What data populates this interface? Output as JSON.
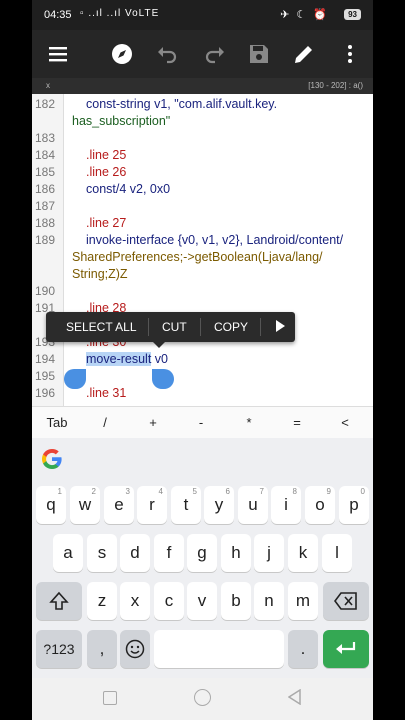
{
  "status": {
    "time": "04:35",
    "left_icons": "▫ ..ıl ..ıl VoLTE",
    "right_icons": "✈ ☾ ⏰",
    "battery": "93"
  },
  "toolbar": {
    "icons": [
      "menu-icon",
      "compass-icon",
      "undo-icon",
      "redo-icon",
      "save-icon",
      "edit-icon",
      "more-vert-icon"
    ]
  },
  "infobar": {
    "close": "x",
    "position": "[130 - 202] : a()"
  },
  "editor": {
    "lines": [
      {
        "n": "182",
        "text": "const-string  v1, \"com.alif.vault.key.",
        "cont": "has_subscription\""
      },
      {
        "n": "183"
      },
      {
        "n": "184",
        "text": ".line 25"
      },
      {
        "n": "185",
        "text": ".line 26"
      },
      {
        "n": "186",
        "text": "const/4  v2, 0x0"
      },
      {
        "n": "187"
      },
      {
        "n": "188",
        "text": ".line 27"
      },
      {
        "n": "189",
        "text": "invoke-interface {v0, v1, v2}, Landroid/content/",
        "cont": "SharedPreferences;->getBoolean(Ljava/lang/",
        "cont2": "String;Z)Z"
      },
      {
        "n": "190"
      },
      {
        "n": "191",
        "text": ".line 28"
      },
      {
        "n": "193",
        "text": ".line 30"
      },
      {
        "n": "194",
        "text": "move-result  v0",
        "selected": "move-result"
      },
      {
        "n": "195"
      },
      {
        "n": "196",
        "text": ".line 31"
      }
    ]
  },
  "context_menu": {
    "items": [
      "SELECT ALL",
      "CUT",
      "COPY"
    ]
  },
  "symbols": [
    "Tab",
    "/",
    "+",
    "-",
    "*",
    "=",
    "<"
  ],
  "keyboard": {
    "row1": [
      {
        "k": "q",
        "h": "1"
      },
      {
        "k": "w",
        "h": "2"
      },
      {
        "k": "e",
        "h": "3"
      },
      {
        "k": "r",
        "h": "4"
      },
      {
        "k": "t",
        "h": "5"
      },
      {
        "k": "y",
        "h": "6"
      },
      {
        "k": "u",
        "h": "7"
      },
      {
        "k": "i",
        "h": "8"
      },
      {
        "k": "o",
        "h": "9"
      },
      {
        "k": "p",
        "h": "0"
      }
    ],
    "row2": [
      "a",
      "s",
      "d",
      "f",
      "g",
      "h",
      "j",
      "k",
      "l"
    ],
    "row3": [
      "z",
      "x",
      "c",
      "v",
      "b",
      "n",
      "m"
    ],
    "num_label": "?123",
    "comma": ",",
    "period": "."
  },
  "colors": {
    "accent": "#34a853",
    "selection": "#b7d4f5",
    "handle": "#4a90e2"
  }
}
